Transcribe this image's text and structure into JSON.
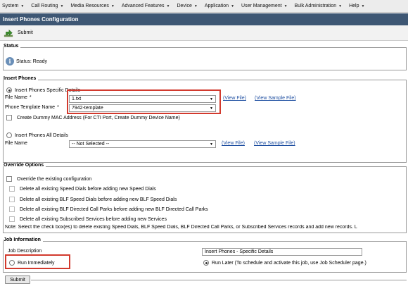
{
  "menu": {
    "items": [
      {
        "label": "System"
      },
      {
        "label": "Call Routing"
      },
      {
        "label": "Media Resources"
      },
      {
        "label": "Advanced Features"
      },
      {
        "label": "Device"
      },
      {
        "label": "Application"
      },
      {
        "label": "User Management"
      },
      {
        "label": "Bulk Administration"
      },
      {
        "label": "Help"
      }
    ]
  },
  "page": {
    "title": "Insert Phones Configuration"
  },
  "toolbar": {
    "submit_label": "Submit"
  },
  "status": {
    "section_title": "Status",
    "text": "Status: Ready"
  },
  "insert_phones": {
    "section_title": "Insert Phones",
    "specific_details_label": "Insert Phones Specific Details",
    "file_name_label": "File Name",
    "required_mark": "*",
    "file_name_value": "1.txt",
    "phone_template_label": "Phone Template Name",
    "phone_template_value": "7942-template",
    "view_file": "(View File)",
    "view_sample_file": "(View Sample File)",
    "dummy_mac_label": "Create Dummy MAC Address (For CTI Port, Create Dummy Device Name)",
    "all_details_label": "Insert Phones All Details",
    "file_name2_label": "File Name",
    "file_name2_value": "-- Not Selected --",
    "view_file2": "(View File)",
    "view_sample_file2": "(View Sample File)"
  },
  "override": {
    "section_title": "Override Options",
    "override_existing": "Override the existing configuration",
    "opt_speed_dials": "Delete all existing Speed Dials before adding new Speed Dials",
    "opt_blf_speed_dials": "Delete all existing BLF Speed Dials before adding new BLF Speed Dials",
    "opt_blf_parks": "Delete all existing BLF Directed Call Parks before adding new BLF Directed Call Parks",
    "opt_subscribed": "Delete all existing Subscribed Services before adding new Services",
    "note": "Note: Select the check box(es) to delete existing Speed Dials, BLF Speed Dials, BLF Directed Call Parks, or Subscribed Services records and add new records. L"
  },
  "job": {
    "section_title": "Job Information",
    "description_label": "Job Description",
    "description_value": "Insert Phones - Specific Details",
    "run_immediately": "Run Immediately",
    "run_later": "Run Later (To schedule and activate this job, use Job Scheduler page.)"
  },
  "footer": {
    "submit_label": "Submit"
  }
}
